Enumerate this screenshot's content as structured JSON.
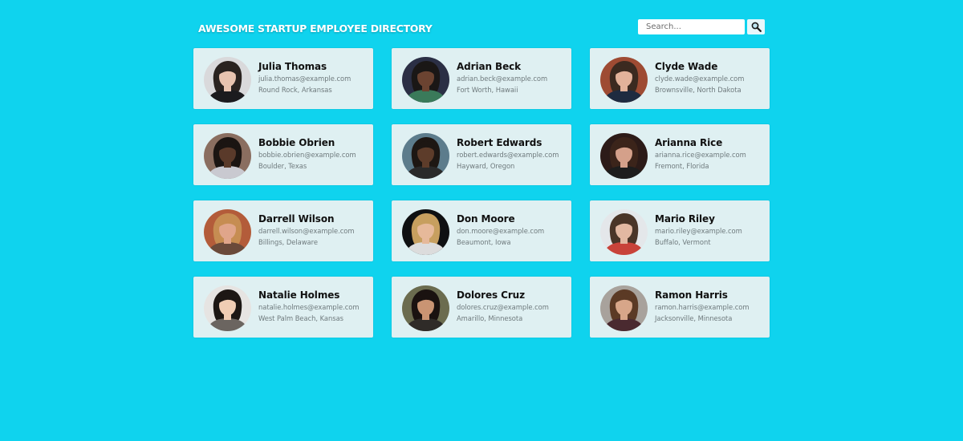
{
  "header": {
    "title": "AWESOME STARTUP EMPLOYEE DIRECTORY"
  },
  "search": {
    "placeholder": "Search..."
  },
  "employees": [
    {
      "name": "Julia Thomas",
      "email": "julia.thomas@example.com",
      "location": "Round Rock, Arkansas",
      "skin": "#e8c4b0",
      "hair": "#2a2320",
      "bg": "#d9d9db",
      "shirt": "#1b1b1e"
    },
    {
      "name": "Adrian Beck",
      "email": "adrian.beck@example.com",
      "location": "Fort Worth, Hawaii",
      "skin": "#6b4331",
      "hair": "#1a1716",
      "bg": "#2b2f45",
      "shirt": "#3a7a5a"
    },
    {
      "name": "Clyde Wade",
      "email": "clyde.wade@example.com",
      "location": "Brownsville, North Dakota",
      "skin": "#e2b29a",
      "hair": "#3b2a20",
      "bg": "#9e4b33",
      "shirt": "#1f2b40"
    },
    {
      "name": "Bobbie Obrien",
      "email": "bobbie.obrien@example.com",
      "location": "Boulder, Texas",
      "skin": "#5a3a2a",
      "hair": "#1b1512",
      "bg": "#8a6e60",
      "shirt": "#c9c9d0"
    },
    {
      "name": "Robert Edwards",
      "email": "robert.edwards@example.com",
      "location": "Hayward, Oregon",
      "skin": "#5d3c2a",
      "hair": "#1d1713",
      "bg": "#5c7c8c",
      "shirt": "#2a2a2a"
    },
    {
      "name": "Arianna Rice",
      "email": "arianna.rice@example.com",
      "location": "Fremont, Florida",
      "skin": "#d4a08a",
      "hair": "#3b241a",
      "bg": "#2c1b18",
      "shirt": "#1d1d1d"
    },
    {
      "name": "Darrell Wilson",
      "email": "darrell.wilson@example.com",
      "location": "Billings, Delaware",
      "skin": "#e0a58a",
      "hair": "#c68d52",
      "bg": "#b35c3a",
      "shirt": "#6a4a3a"
    },
    {
      "name": "Don Moore",
      "email": "don.moore@example.com",
      "location": "Beaumont, Iowa",
      "skin": "#e6b99a",
      "hair": "#c79f5f",
      "bg": "#0f1012",
      "shirt": "#dcdcdc"
    },
    {
      "name": "Mario Riley",
      "email": "mario.riley@example.com",
      "location": "Buffalo, Vermont",
      "skin": "#e2b8a2",
      "hair": "#4a3528",
      "bg": "#e4e7ea",
      "shirt": "#c8433a"
    },
    {
      "name": "Natalie Holmes",
      "email": "natalie.holmes@example.com",
      "location": "West Palm Beach, Kansas",
      "skin": "#f0cdb4",
      "hair": "#1d1714",
      "bg": "#e6e4e2",
      "shirt": "#6b6560"
    },
    {
      "name": "Dolores Cruz",
      "email": "dolores.cruz@example.com",
      "location": "Amarillo, Minnesota",
      "skin": "#c99473",
      "hair": "#1a1210",
      "bg": "#6b6c4f",
      "shirt": "#2f2b28"
    },
    {
      "name": "Ramon Harris",
      "email": "ramon.harris@example.com",
      "location": "Jacksonville, Minnesota",
      "skin": "#d7a689",
      "hair": "#5b3a25",
      "bg": "#a8a29c",
      "shirt": "#4a2a30"
    }
  ]
}
